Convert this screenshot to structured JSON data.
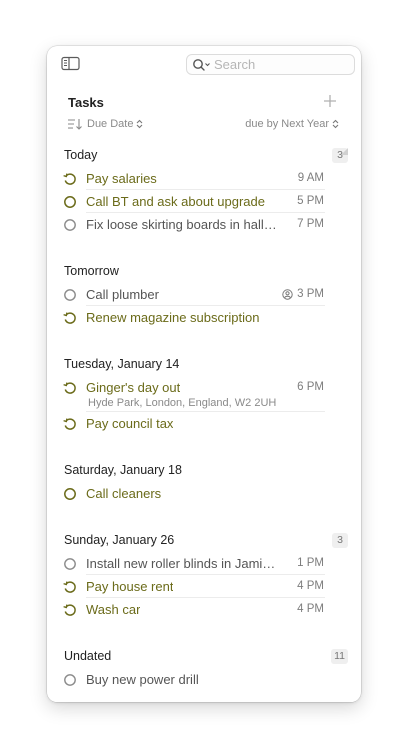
{
  "toolbar": {
    "search_placeholder": "Search",
    "icons": {
      "sidebar": "sidebar-toggle-icon",
      "search": "search-icon"
    }
  },
  "header": {
    "title": "Tasks",
    "sort_label": "Due Date",
    "filter_label": "due by Next Year",
    "icons": {
      "add": "plus-icon",
      "sort": "sort-icon",
      "chevron": "chevron-updown-icon"
    }
  },
  "colors": {
    "flagged_text": "#6b6b1a",
    "repeat_icon": "#6b6b1a",
    "open_circle": "#8a8a8a",
    "badge_bg": "#efefef"
  },
  "sections": [
    {
      "title": "Today",
      "count": "3",
      "tasks": [
        {
          "label": "Pay salaries",
          "time": "9 AM",
          "status": "repeat",
          "flagged": true
        },
        {
          "label": "Call BT and ask about upgrade",
          "time": "5 PM",
          "status": "open",
          "flagged": true
        },
        {
          "label": "Fix loose skirting boards in hallway",
          "time": "7 PM",
          "status": "open",
          "flagged": false
        }
      ]
    },
    {
      "title": "Tomorrow",
      "count": "",
      "tasks": [
        {
          "label": "Call plumber",
          "time": "3 PM",
          "status": "open",
          "flagged": false,
          "icon": "person-icon"
        },
        {
          "label": "Renew magazine subscription",
          "time": "",
          "status": "repeat",
          "flagged": true
        }
      ]
    },
    {
      "title": "Tuesday, January 14",
      "count": "",
      "tasks": [
        {
          "label": "Ginger's day out",
          "time": "6 PM",
          "status": "repeat",
          "flagged": true,
          "location": "Hyde Park, London, England, W2 2UH"
        },
        {
          "label": "Pay council tax",
          "time": "",
          "status": "repeat",
          "flagged": true
        }
      ]
    },
    {
      "title": "Saturday, January 18",
      "count": "",
      "tasks": [
        {
          "label": "Call cleaners",
          "time": "",
          "status": "open",
          "flagged": true
        }
      ]
    },
    {
      "title": "Sunday, January 26",
      "count": "3",
      "tasks": [
        {
          "label": "Install new roller blinds in Jamie's room",
          "time": "1 PM",
          "status": "open",
          "flagged": false
        },
        {
          "label": "Pay house rent",
          "time": "4 PM",
          "status": "repeat",
          "flagged": true
        },
        {
          "label": "Wash car",
          "time": "4 PM",
          "status": "repeat",
          "flagged": true
        }
      ]
    },
    {
      "title": "Undated",
      "count": "11",
      "tasks": [
        {
          "label": "Buy new power drill",
          "time": "",
          "status": "open",
          "flagged": false
        }
      ]
    }
  ]
}
